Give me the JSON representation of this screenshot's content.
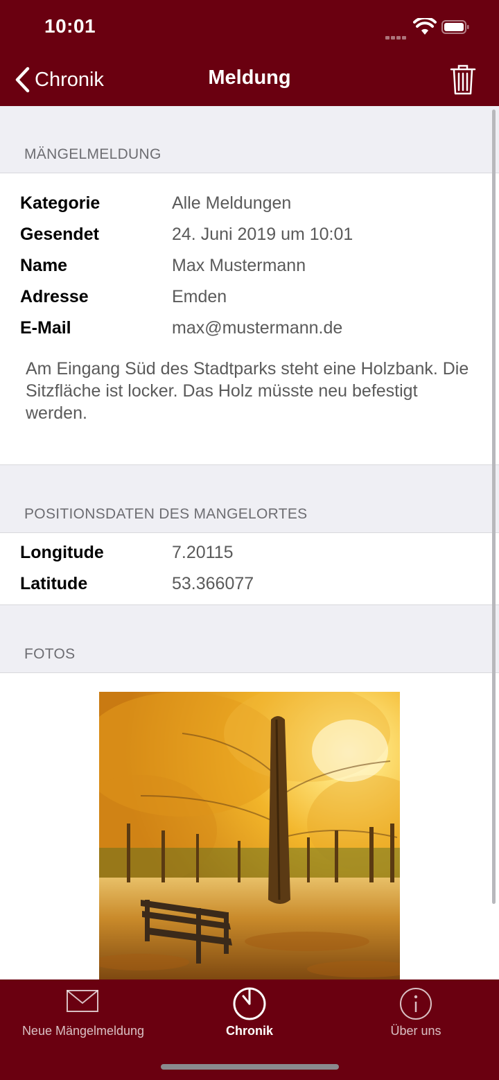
{
  "status_bar": {
    "time": "10:01"
  },
  "nav": {
    "back_label": "Chronik",
    "title": "Meldung",
    "trash_icon": "trash-icon"
  },
  "report_section": {
    "header": "MÄNGELMELDUNG",
    "rows": [
      {
        "label": "Kategorie",
        "value": "Alle Meldungen"
      },
      {
        "label": "Gesendet",
        "value": "24. Juni 2019 um 10:01"
      },
      {
        "label": "Name",
        "value": "Max Mustermann"
      },
      {
        "label": "Adresse",
        "value": "Emden"
      },
      {
        "label": "E-Mail",
        "value": "max@mustermann.de"
      }
    ],
    "description": "Am Eingang Süd des Stadtparks steht eine Holzbank. Die Sitzfläche ist locker. Das Holz müsste neu befestigt werden."
  },
  "position_section": {
    "header": "POSITIONSDATEN DES MANGELORTES",
    "rows": [
      {
        "label": "Longitude",
        "value": "7.20115"
      },
      {
        "label": "Latitude",
        "value": "53.366077"
      }
    ]
  },
  "photos_section": {
    "header": "FOTOS",
    "photo_subject": "autumn park with wooden bench"
  },
  "tabbar": {
    "tabs": [
      {
        "label": "Neue Mängelmeldung",
        "icon": "envelope-icon",
        "active": false
      },
      {
        "label": "Chronik",
        "icon": "clock-icon",
        "active": true
      },
      {
        "label": "Über uns",
        "icon": "info-icon",
        "active": false
      }
    ]
  },
  "colors": {
    "brand": "#6a0010",
    "background": "#efeff4",
    "secondary_text": "#5a5a5a",
    "section_header": "#6d6d72"
  }
}
